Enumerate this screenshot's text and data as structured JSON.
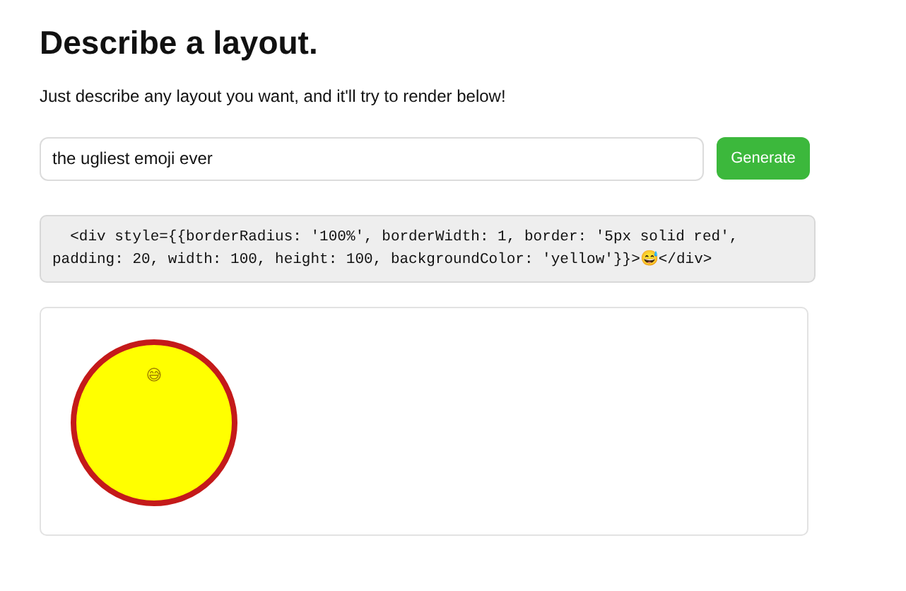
{
  "heading": "Describe a layout.",
  "subtitle": "Just describe any layout you want, and it'll try to render below!",
  "prompt_field": {
    "value": "the ugliest emoji ever"
  },
  "generate_button": {
    "label": "Generate"
  },
  "code_box": {
    "value": "  <div style={{borderRadius: '100%', borderWidth: 1, border: '5px solid red', padding: 20, width: 100, height: 100, backgroundColor: 'yellow'}}>😅</div>"
  },
  "preview": {
    "content": "😅"
  }
}
